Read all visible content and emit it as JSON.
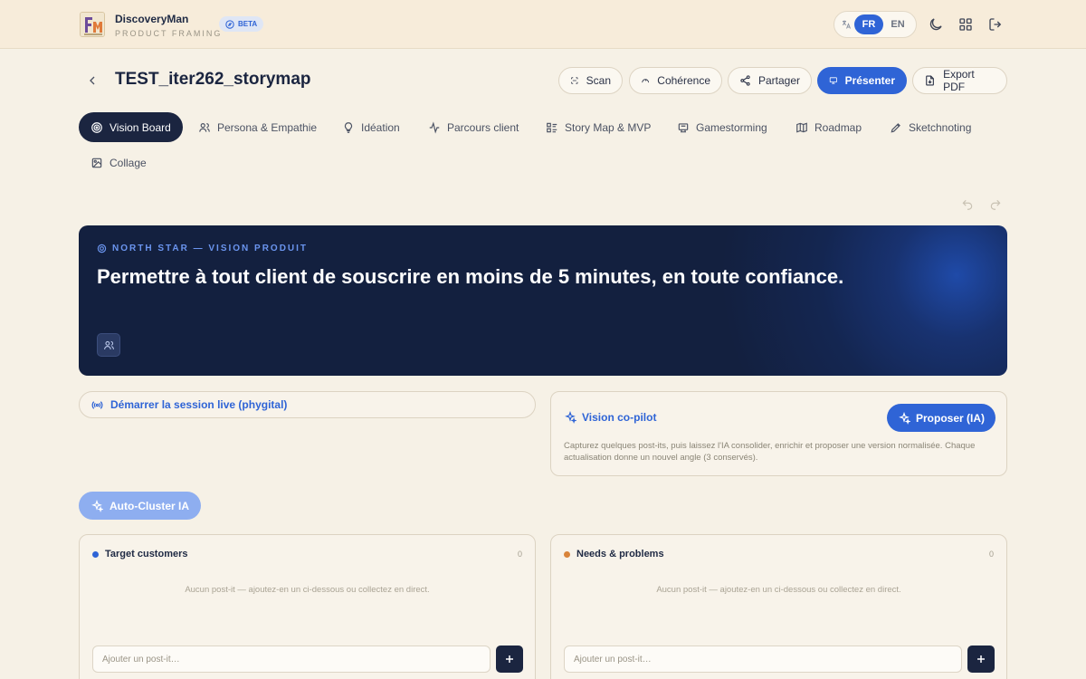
{
  "header": {
    "app_name": "DiscoveryMan",
    "app_subtitle": "PRODUCT FRAMING",
    "beta_label": "BETA",
    "lang_options": [
      "FR",
      "EN"
    ],
    "active_lang": "FR",
    "icons": [
      "translate-icon",
      "moon-icon",
      "grid-icon",
      "logout-icon"
    ]
  },
  "page": {
    "title": "TEST_iter262_storymap",
    "actions": [
      "Scan",
      "Cohérence",
      "Partager",
      "Présenter",
      "Export PDF"
    ]
  },
  "tabs": [
    {
      "label": "Vision Board",
      "icon": "target-icon",
      "active": true
    },
    {
      "label": "Persona & Empathie",
      "icon": "users-icon"
    },
    {
      "label": "Idéation",
      "icon": "lightbulb-icon"
    },
    {
      "label": "Parcours client",
      "icon": "activity-icon"
    },
    {
      "label": "Story Map & MVP",
      "icon": "list-icon"
    },
    {
      "label": "Gamestorming",
      "icon": "award-icon"
    },
    {
      "label": "Roadmap",
      "icon": "map-icon"
    },
    {
      "label": "Sketchnoting",
      "icon": "pen-icon"
    },
    {
      "label": "Collage",
      "icon": "image-icon"
    }
  ],
  "hero": {
    "kicker": "NORTH STAR — VISION PRODUIT",
    "statement": "Permettre à tout client de souscrire en moins de 5 minutes, en toute confiance."
  },
  "live": {
    "label": "Démarrer la session live (phygital)"
  },
  "copilot": {
    "title": "Vision co-pilot",
    "button": "Proposer (IA)",
    "description": "Capturez quelques post-its, puis laissez l'IA consolider, enrichir et proposer une version normalisée. Chaque actualisation donne un nouvel angle (3 conservés)."
  },
  "autocluster": {
    "label": "Auto-Cluster IA"
  },
  "columns": [
    {
      "title": "Target customers",
      "count": "0",
      "color": "#2f64d6",
      "empty": "Aucun post-it — ajoutez-en un ci-dessous ou collectez en direct.",
      "placeholder": "Ajouter un post-it…"
    },
    {
      "title": "Needs & problems",
      "count": "0",
      "color": "#d9843b",
      "empty": "Aucun post-it — ajoutez-en un ci-dessous ou collectez en direct.",
      "placeholder": "Ajouter un post-it…"
    }
  ],
  "colors": {
    "accent": "#2f64d6",
    "navy": "#1b2540",
    "background": "#f6f1e6"
  }
}
